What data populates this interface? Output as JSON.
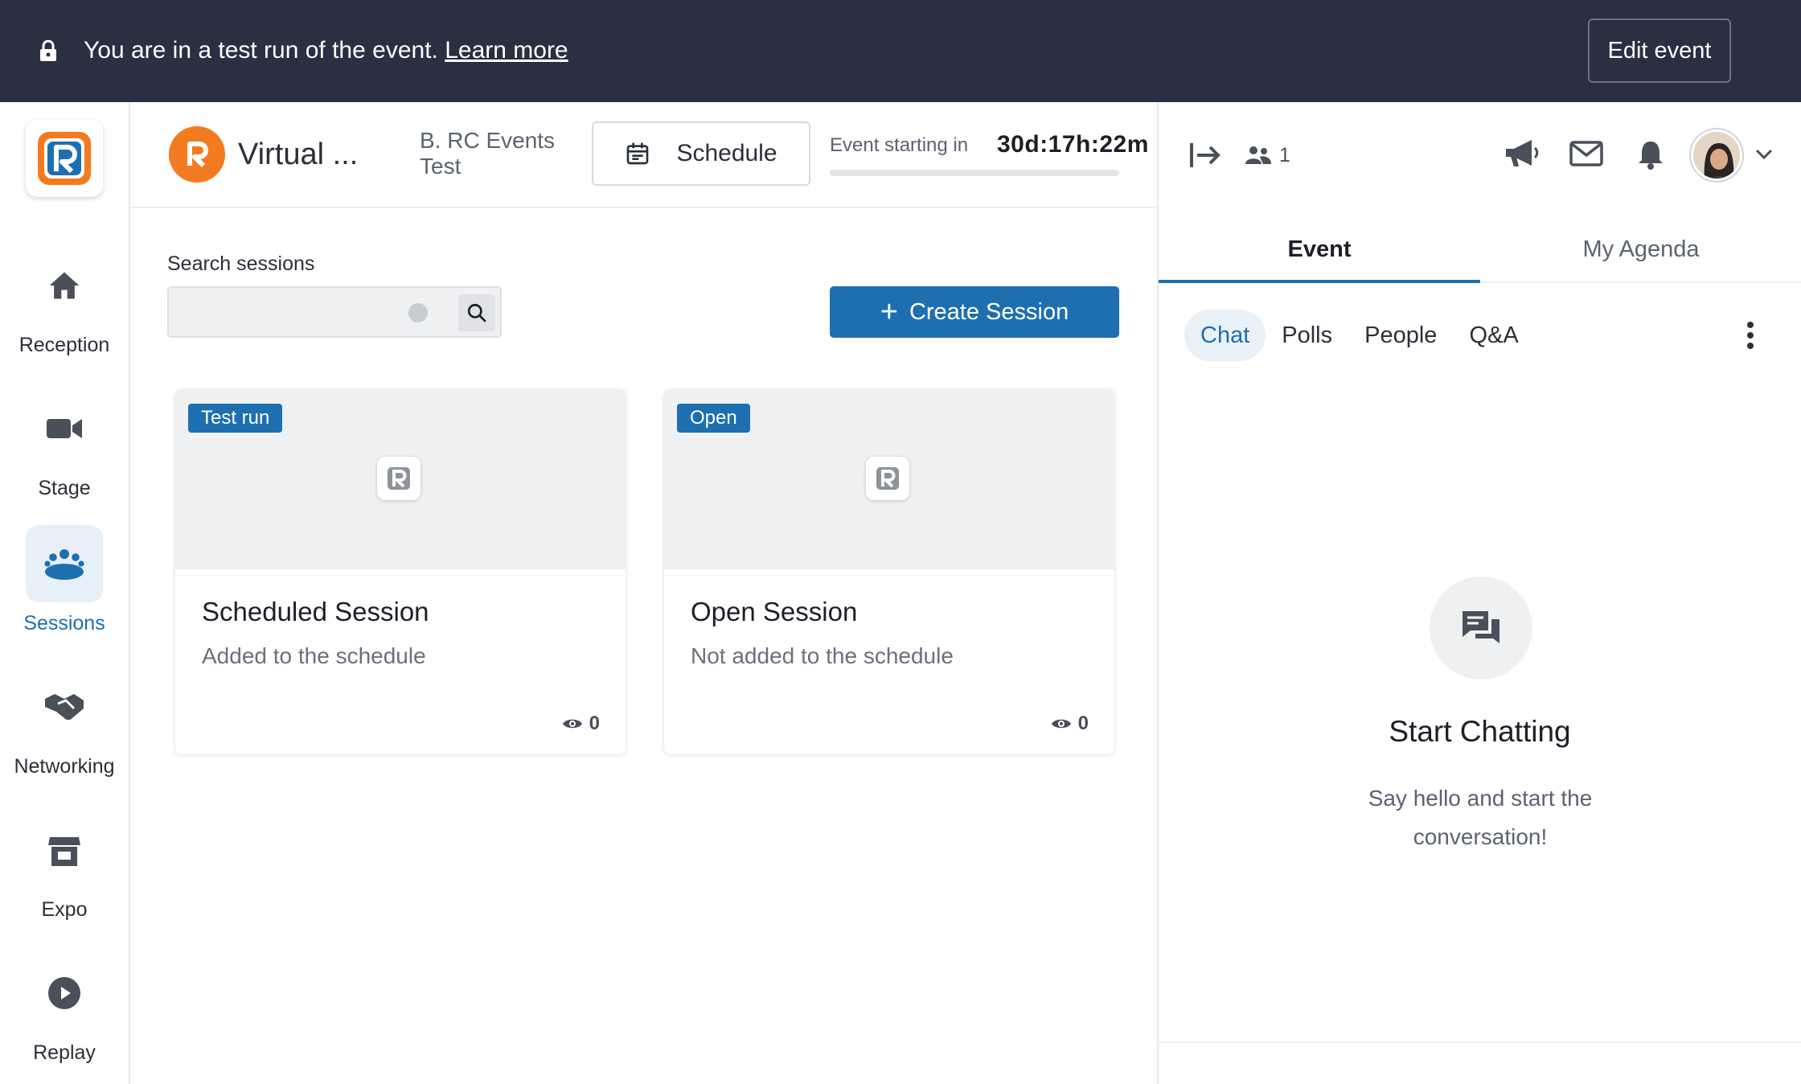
{
  "banner": {
    "message": "You are in a test run of the event.",
    "learn_more": "Learn more",
    "edit_event": "Edit event"
  },
  "nav": {
    "items": [
      {
        "label": "Reception",
        "icon": "home-icon"
      },
      {
        "label": "Stage",
        "icon": "video-camera-icon"
      },
      {
        "label": "Sessions",
        "icon": "people-group-icon",
        "active": true
      },
      {
        "label": "Networking",
        "icon": "handshake-icon"
      },
      {
        "label": "Expo",
        "icon": "booth-icon"
      },
      {
        "label": "Replay",
        "icon": "play-icon"
      }
    ]
  },
  "header": {
    "event_name": "Virtual ...",
    "org_name": "B. RC Events Test",
    "schedule_label": "Schedule",
    "countdown_label": "Event starting in",
    "countdown_value": "30d:17h:22m"
  },
  "main": {
    "search_label": "Search sessions",
    "search_value": "",
    "create_label": "Create Session",
    "cards": [
      {
        "badge": "Test run",
        "title": "Scheduled Session",
        "subtitle": "Added to the schedule",
        "views": "0"
      },
      {
        "badge": "Open",
        "title": "Open Session",
        "subtitle": "Not added to the schedule",
        "views": "0"
      }
    ]
  },
  "right": {
    "attendee_count": "1",
    "tabs": [
      "Event",
      "My Agenda"
    ],
    "subtabs": [
      "Chat",
      "Polls",
      "People",
      "Q&A"
    ],
    "chat_title": "Start Chatting",
    "chat_subtitle": "Say hello and start the conversation!"
  },
  "colors": {
    "banner_bg": "#2a3042",
    "accent": "#1e6fb0",
    "brand_orange": "#f47a20"
  }
}
